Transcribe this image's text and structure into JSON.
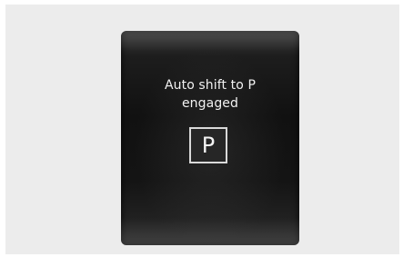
{
  "display": {
    "message_line1": "Auto shift to P",
    "message_line2": "engaged",
    "gear_label": "P"
  },
  "colors": {
    "display_background": "#141414",
    "text": "#f2f2f2",
    "gear_border": "#d9d9d9",
    "page_background": "#ececec"
  }
}
